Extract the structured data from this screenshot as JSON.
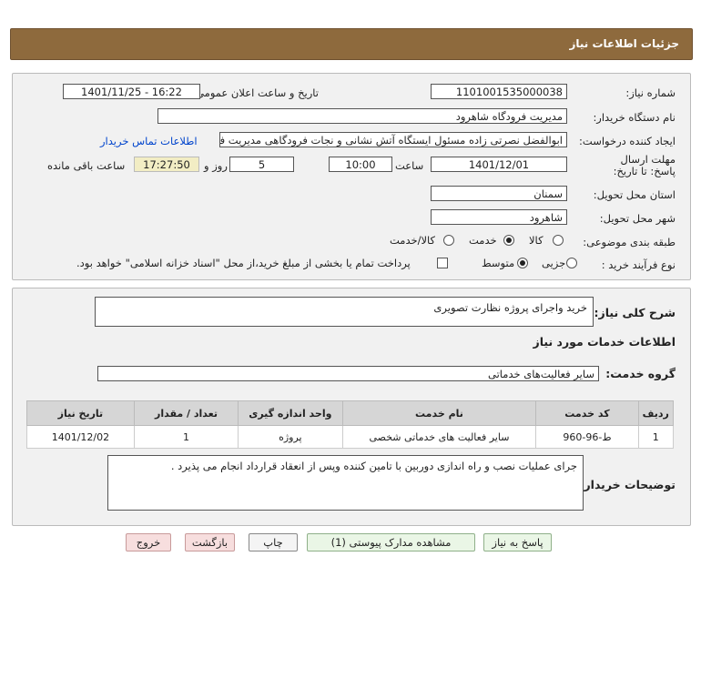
{
  "header": {
    "title": "جزئیات اطلاعات نیاز"
  },
  "form": {
    "need_number_label": "شماره نیاز:",
    "need_number": "1101001535000038",
    "announce_label": "تاریخ و ساعت اعلان عمومی:",
    "announce_value": "1401/11/25 - 16:22",
    "buyer_org_label": "نام دستگاه خریدار:",
    "buyer_org": "مدیریت فرودگاه شاهرود",
    "creator_label": "ایجاد کننده درخواست:",
    "creator": "ابوالفضل نصرتی زاده مسئول ایستگاه آتش نشانی و نجات فرودگاهی مدیریت فر",
    "contact_link": "اطلاعات تماس خریدار",
    "deadline_label": "مهلت ارسال پاسخ: تا تاریخ:",
    "deadline_date": "1401/12/01",
    "time_label": "ساعت",
    "deadline_time": "10:00",
    "days": "5",
    "days_label": "روز و",
    "remaining_time": "17:27:50",
    "remaining_label": "ساعت باقی مانده",
    "province_label": "استان محل تحویل:",
    "province": "سمنان",
    "city_label": "شهر محل تحویل:",
    "city": "شاهرود",
    "category_label": "طبقه بندی موضوعی:",
    "category_options": [
      "کالا",
      "خدمت",
      "کالا/خدمت"
    ],
    "category_selected": "خدمت",
    "purchase_type_label": "نوع فرآیند خرید :",
    "purchase_options": [
      "جزیی",
      "متوسط"
    ],
    "purchase_selected": "متوسط",
    "payment_note": "پرداخت تمام یا بخشی از مبلغ خرید،از محل \"اسناد خزانه اسلامی\" خواهد بود."
  },
  "details": {
    "summary_label": "شرح کلی نیاز:",
    "summary": "خرید واجرای پروژه نظارت تصویری",
    "services_heading": "اطلاعات خدمات مورد نیاز",
    "service_group_label": "گروه خدمت:",
    "service_group": "سایر فعالیت‌های خدماتی",
    "table": {
      "headers": [
        "ردیف",
        "کد خدمت",
        "نام خدمت",
        "واحد اندازه گیری",
        "تعداد / مقدار",
        "تاریخ نیاز"
      ],
      "rows": [
        [
          "1",
          "ط-96-960",
          "سایر فعالیت های خدماتی شخصی",
          "پروژه",
          "1",
          "1401/12/02"
        ]
      ]
    },
    "buyer_notes_label": "توضیحات خریدار:",
    "buyer_notes": "جرای عملیات نصب و راه اندازی دوربین با تامین کننده وپس از انعقاد قرارداد انجام می پذیرد ."
  },
  "buttons": {
    "reply": "پاسخ به نیاز",
    "attachments": "مشاهده مدارک پیوستی (1)",
    "print": "چاپ",
    "back": "بازگشت",
    "exit": "خروج"
  }
}
